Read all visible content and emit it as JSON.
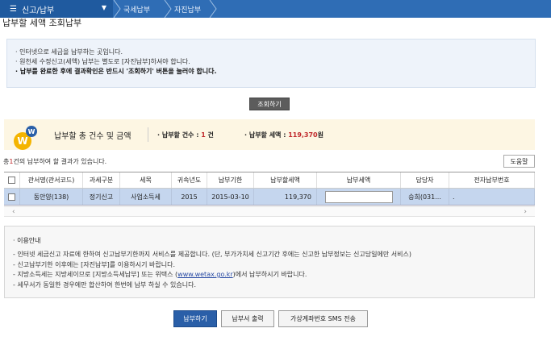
{
  "topbar": {
    "menu_label": "신고/납부",
    "breadcrumbs": [
      "국세납부",
      "자진납부"
    ]
  },
  "page_title": "납부할 세액 조회납부",
  "notice": [
    {
      "text": "인터넷으로 세금을 납부하는 곳입니다.",
      "bold": false
    },
    {
      "text": "원천세 수정신고(세액) 납부는 별도로 [자진납부]하셔야 합니다.",
      "bold": false
    },
    {
      "text": "납부를 완료한 후에 결과확인은 반드시 '조회하기' 버튼을 눌러야 합니다.",
      "bold": true
    }
  ],
  "query_button": "조회하기",
  "summary": {
    "title": "납부할 총 건수 및 금액",
    "count_label": "납부할 건수 : ",
    "count_value": "1",
    "count_unit": " 건",
    "amount_label": "납부할 세액 : ",
    "amount_value": "119,370",
    "amount_unit": "원"
  },
  "result": {
    "prefix": "총",
    "count": "1",
    "suffix": "건의 납부하여 할 결과가 있습니다."
  },
  "help_button": "도움말",
  "table": {
    "headers": [
      "관서명(관서코드)",
      "과세구분",
      "세목",
      "귀속년도",
      "납부기한",
      "납부할세액",
      "납부세액",
      "담당자",
      "전자납부번호"
    ],
    "rows": [
      [
        "동안양(138)",
        "정기신고",
        "사업소득세",
        "2015",
        "2015-03-10",
        "119,370",
        "",
        "승희(031...",
        "."
      ]
    ]
  },
  "guide": {
    "title": "· 이용안내",
    "items": [
      {
        "text": "인터넷 세금신고 자료에 한하여 신고납부기한까지 서비스를 제공합니다. (단, 부가가치세 신고기간 후에는 신고한 납부정보는 신고당일에만 서비스)"
      },
      {
        "text": "신고납부기한 이후에는 [자진납부]를 이용하시기 바랍니다."
      },
      {
        "text_before": "지방소득세는 지방세이므로 [지방소득세납부] 또는 위택스 (",
        "link": "www.wetax.go.kr",
        "text_after": ")에서 납부하시기 바랍니다."
      },
      {
        "text": "세무서가 동일한 경우에만 합산하여 한번에 납부 하실 수 있습니다."
      }
    ]
  },
  "buttons": {
    "pay": "납부하기",
    "print": "납부서 출력",
    "sms": "가상계좌번호 SMS 전송"
  }
}
